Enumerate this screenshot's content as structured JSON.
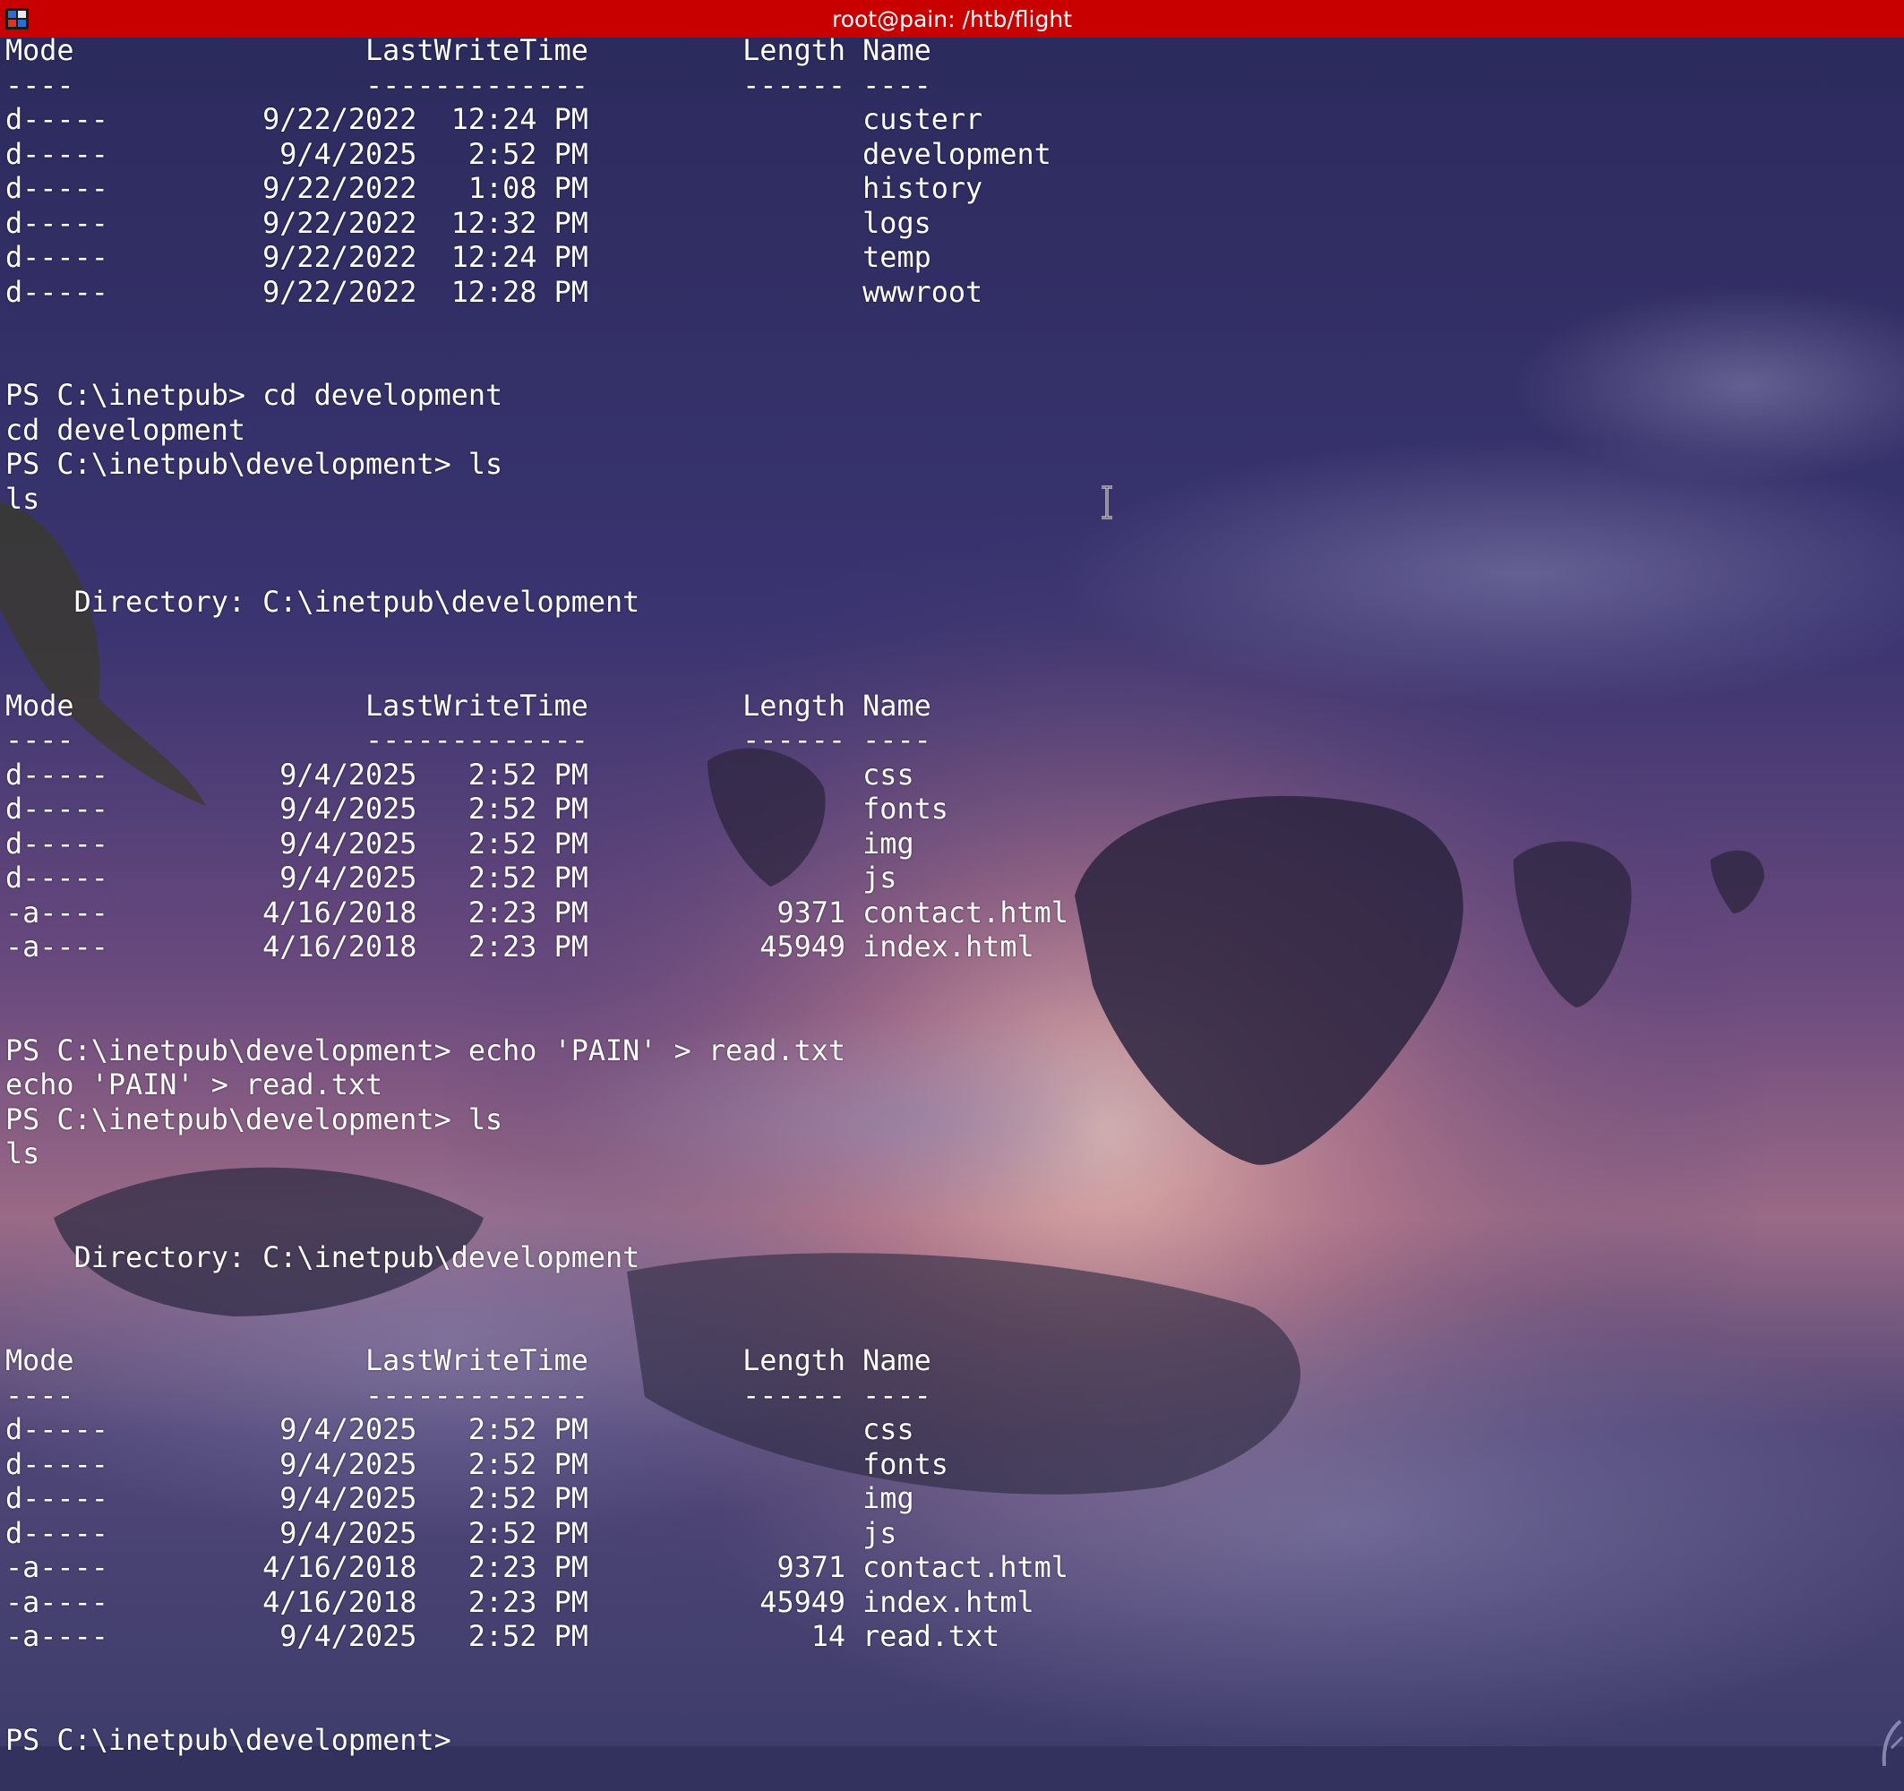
{
  "window": {
    "title": "root@pain: /htb/flight"
  },
  "terminal": {
    "lines": [
      "Mode                 LastWriteTime         Length Name",
      "----                 -------------         ------ ----",
      "d-----         9/22/2022  12:24 PM                custerr",
      "d-----          9/4/2025   2:52 PM                development",
      "d-----         9/22/2022   1:08 PM                history",
      "d-----         9/22/2022  12:32 PM                logs",
      "d-----         9/22/2022  12:24 PM                temp",
      "d-----         9/22/2022  12:28 PM                wwwroot",
      "",
      "",
      "PS C:\\inetpub> cd development",
      "cd development",
      "PS C:\\inetpub\\development> ls",
      "ls",
      "",
      "",
      "    Directory: C:\\inetpub\\development",
      "",
      "",
      "Mode                 LastWriteTime         Length Name",
      "----                 -------------         ------ ----",
      "d-----          9/4/2025   2:52 PM                css",
      "d-----          9/4/2025   2:52 PM                fonts",
      "d-----          9/4/2025   2:52 PM                img",
      "d-----          9/4/2025   2:52 PM                js",
      "-a----         4/16/2018   2:23 PM           9371 contact.html",
      "-a----         4/16/2018   2:23 PM          45949 index.html",
      "",
      "",
      "PS C:\\inetpub\\development> echo 'PAIN' > read.txt",
      "echo 'PAIN' > read.txt",
      "PS C:\\inetpub\\development> ls",
      "ls",
      "",
      "",
      "    Directory: C:\\inetpub\\development",
      "",
      "",
      "Mode                 LastWriteTime         Length Name",
      "----                 -------------         ------ ----",
      "d-----          9/4/2025   2:52 PM                css",
      "d-----          9/4/2025   2:52 PM                fonts",
      "d-----          9/4/2025   2:52 PM                img",
      "d-----          9/4/2025   2:52 PM                js",
      "-a----         4/16/2018   2:23 PM           9371 contact.html",
      "-a----         4/16/2018   2:23 PM          45949 index.html",
      "-a----          9/4/2025   2:52 PM             14 read.txt",
      "",
      "",
      "PS C:\\inetpub\\development> "
    ]
  },
  "icons": {
    "app": "terminal-app-icon",
    "pointer": "text-cursor-icon",
    "corner": "corner-grip-icon"
  },
  "colors": {
    "titlebar": "#c80000",
    "text": "#ffffff"
  }
}
